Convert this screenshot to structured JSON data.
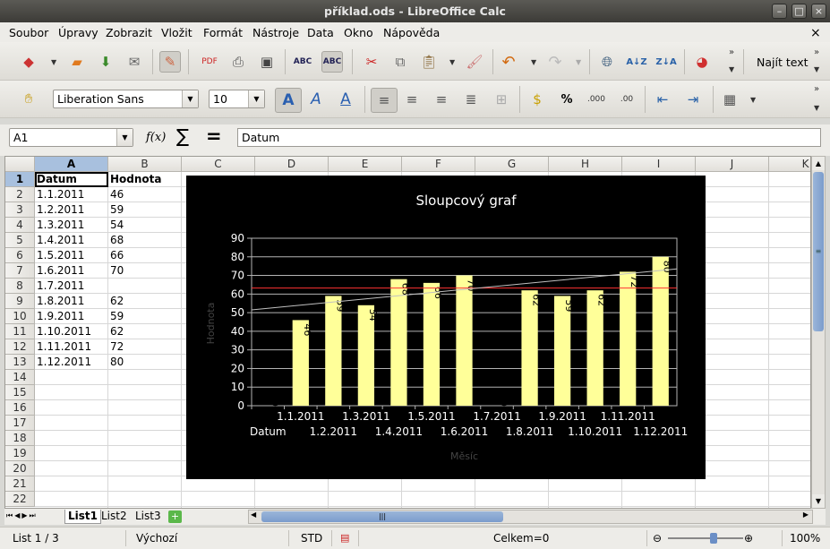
{
  "window": {
    "title": "příklad.ods - LibreOffice Calc"
  },
  "menu": [
    "Soubor",
    "Úpravy",
    "Zobrazit",
    "Vložit",
    "Formát",
    "Nástroje",
    "Data",
    "Okno",
    "Nápověda"
  ],
  "toolbar": {
    "find_text": "Najít text"
  },
  "format": {
    "font_name": "Liberation Sans",
    "font_size": "10"
  },
  "formula": {
    "cell_ref": "A1",
    "fx": "f(x)",
    "sum": "∑",
    "equals": "=",
    "content": "Datum"
  },
  "columns": [
    "A",
    "B",
    "C",
    "D",
    "E",
    "F",
    "G",
    "H",
    "I",
    "J",
    "K"
  ],
  "rows": [
    "1",
    "2",
    "3",
    "4",
    "5",
    "6",
    "7",
    "8",
    "9",
    "10",
    "11",
    "12",
    "13",
    "14",
    "15",
    "16",
    "17",
    "18",
    "19",
    "20",
    "21",
    "22"
  ],
  "cells": {
    "A": [
      "Datum",
      "1.1.2011",
      "1.2.2011",
      "1.3.2011",
      "1.4.2011",
      "1.5.2011",
      "1.6.2011",
      "1.7.2011",
      "1.8.2011",
      "1.9.2011",
      "1.10.2011",
      "1.11.2011",
      "1.12.2011"
    ],
    "B": [
      "Hodnota",
      "46",
      "59",
      "54",
      "68",
      "66",
      "70",
      "",
      "62",
      "59",
      "62",
      "72",
      "80"
    ]
  },
  "chart_data": {
    "type": "bar",
    "title": "Sloupcový graf",
    "xlabel": "Měsíc",
    "ylabel": "Hodnota",
    "first_category_label": "Datum",
    "categories": [
      "1.1.2011",
      "1.2.2011",
      "1.3.2011",
      "1.4.2011",
      "1.5.2011",
      "1.6.2011",
      "1.7.2011",
      "1.8.2011",
      "1.9.2011",
      "1.10.2011",
      "1.11.2011",
      "1.12.2011"
    ],
    "values": [
      0,
      46,
      59,
      54,
      68,
      66,
      70,
      0,
      62,
      59,
      62,
      72,
      80
    ],
    "data_labels": [
      "0",
      "46",
      "59",
      "54",
      "68",
      "66",
      "70",
      "0",
      "62",
      "59",
      "62",
      "72",
      "80"
    ],
    "ylim": [
      0,
      90
    ],
    "yticks": [
      0,
      10,
      20,
      30,
      40,
      50,
      60,
      70,
      80,
      90
    ],
    "mean_line": 63.23,
    "trend_line": {
      "start": 51.5,
      "end": 73.5
    },
    "bar_color": "#ffff99",
    "mean_color": "#ff3333",
    "trend_color": "#c0c0c0",
    "background": "#000000",
    "grid": true,
    "legend": "none"
  },
  "sheets": [
    "List1",
    "List2",
    "List3"
  ],
  "status": {
    "sheet": "List 1 / 3",
    "style": "Výchozí",
    "mode": "STD",
    "sum": "Celkem=0",
    "zoom": "100%"
  }
}
